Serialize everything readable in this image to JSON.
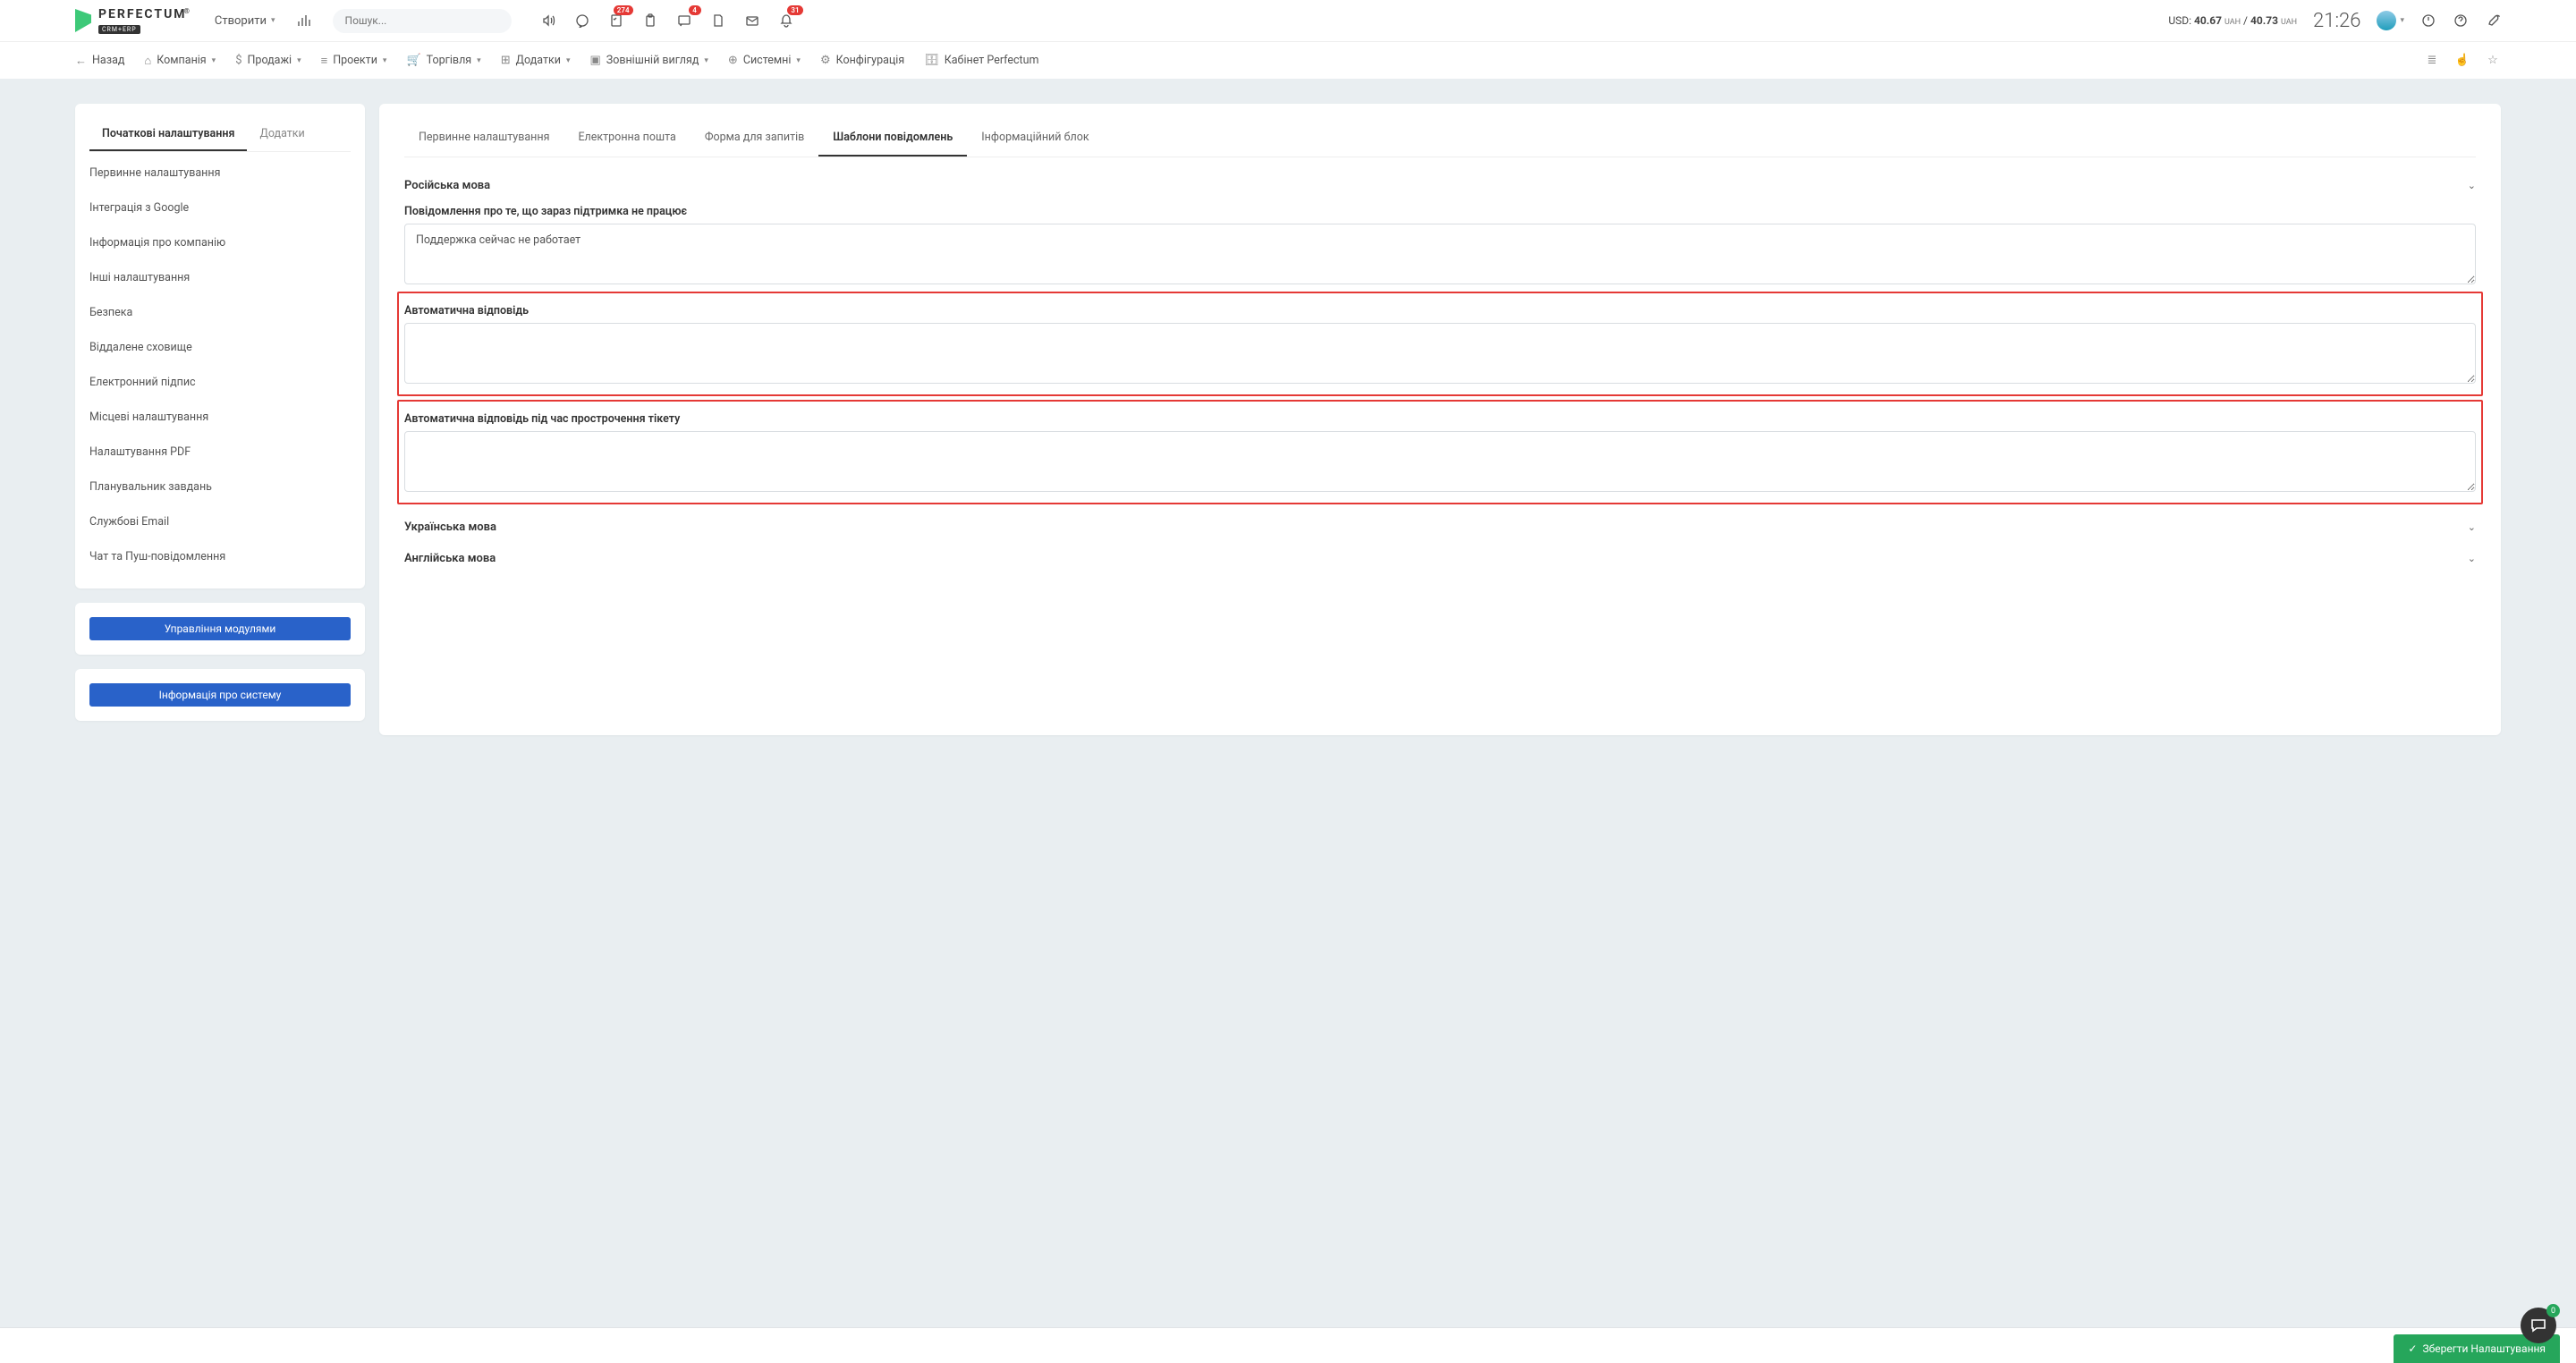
{
  "top": {
    "logo_text": "PERFECTUM",
    "logo_sub": "CRM+ERP",
    "create": "Створити",
    "search_placeholder": "Пошук...",
    "rate_prefix": "USD:",
    "rate_buy": "40.67",
    "rate_sep": "/",
    "rate_sell": "40.73",
    "currency": "UAH",
    "time": "21:26",
    "badges": {
      "check": "274",
      "chat": "4",
      "bell": "31"
    }
  },
  "nav": {
    "back": "Назад",
    "items": [
      "Компанія",
      "Продажі",
      "Проекти",
      "Торгівля",
      "Додатки",
      "Зовнішній вигляд",
      "Системні",
      "Конфігурація",
      "Кабінет Perfectum"
    ]
  },
  "side": {
    "tabs": [
      "Початкові налаштування",
      "Додатки"
    ],
    "links": [
      "Первинне налаштування",
      "Інтеграція з Google",
      "Інформація про компанію",
      "Інші налаштування",
      "Безпека",
      "Віддалене сховище",
      "Електронний підпис",
      "Місцеві налаштування",
      "Налаштування PDF",
      "Планувальник завдань",
      "Службові Email",
      "Чат та Пуш-повідомлення"
    ],
    "btn1": "Управління модулями",
    "btn2": "Інформація про систему"
  },
  "main": {
    "tabs": [
      "Первинне налаштування",
      "Електронна пошта",
      "Форма для запитів",
      "Шаблони повідомлень",
      "Інформаційний блок"
    ],
    "sec_ru": "Російська мова",
    "f1_label": "Повідомлення про те, що зараз підтримка не працює",
    "f1_value": "Поддержка сейчас не работает",
    "f2_label": "Автоматична відповідь",
    "f2_value": "",
    "f3_label": "Автоматична відповідь під час прострочення тікету",
    "f3_value": "",
    "sec_ua": "Українська мова",
    "sec_en": "Англійська мова"
  },
  "footer": {
    "save": "Зберегти Налаштування"
  },
  "fab": {
    "count": "0"
  }
}
